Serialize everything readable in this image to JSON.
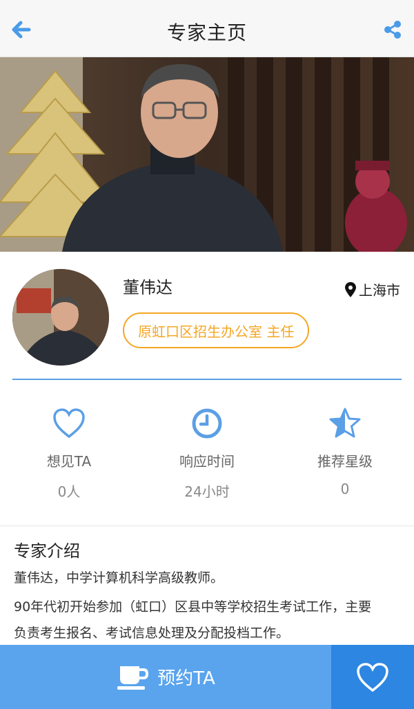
{
  "header": {
    "title": "专家主页",
    "back_icon": "arrow-left-icon",
    "share_icon": "share-icon"
  },
  "expert": {
    "name": "董伟达",
    "location": "上海市",
    "position": "原虹口区招生办公室 主任"
  },
  "stats": [
    {
      "label": "想见TA",
      "value": "0人",
      "icon": "heart-outline-icon"
    },
    {
      "label": "响应时间",
      "value": "24小时",
      "icon": "clock-icon"
    },
    {
      "label": "推荐星级",
      "value": "0",
      "icon": "star-half-icon"
    }
  ],
  "intro": {
    "heading": "专家介绍",
    "lines": [
      "董伟达，中学计算机科学高级教师。",
      "90年代初开始参加（虹口）区县中等学校招生考试工作，主要",
      "负责考生报名、考试信息处理及分配投档工作。"
    ]
  },
  "actions": {
    "book_label": "预约TA",
    "book_icon": "coffee-cup-icon",
    "favorite_icon": "heart-outline-icon"
  },
  "colors": {
    "accent": "#5aa4ee",
    "accent_dark": "#2d86e2",
    "badge": "#f5a623",
    "icon_blue": "#5b9fe6"
  }
}
